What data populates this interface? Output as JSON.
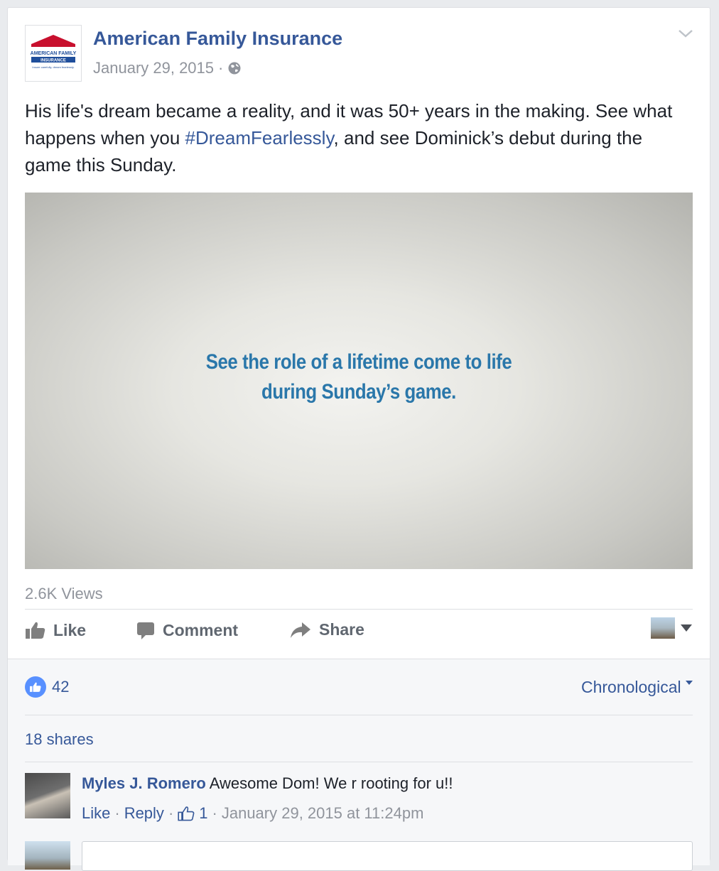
{
  "post": {
    "page_name": "American Family Insurance",
    "date": "January 29, 2015",
    "separator": "·",
    "text_part1": "His life's dream became a reality, and it was 50+ years in the making. See what happens when you ",
    "hashtag": "#DreamFearlessly",
    "text_part2": ", and see Dominick’s debut during the game this Sunday.",
    "logo": {
      "line1": "AMERICAN FAMILY",
      "line2": "INSURANCE",
      "tagline": "Insure carefully, dream fearlessly."
    },
    "video": {
      "caption_line1": "See the role of a lifetime come to life",
      "caption_line2": "during Sunday’s game."
    },
    "views": "2.6K Views"
  },
  "actions": {
    "like": "Like",
    "comment": "Comment",
    "share": "Share"
  },
  "stats": {
    "like_count": "42",
    "sort_label": "Chronological",
    "shares": "18 shares"
  },
  "comments": [
    {
      "author": "Myles J. Romero",
      "text": "Awesome Dom! We r rooting for u!!",
      "like_label": "Like",
      "reply_label": "Reply",
      "likes": "1",
      "timestamp": "January 29, 2015 at 11:24pm"
    }
  ],
  "colors": {
    "link": "#365899",
    "muted": "#90949c",
    "caption": "#2a77aa",
    "like_badge": "#5890ff"
  }
}
